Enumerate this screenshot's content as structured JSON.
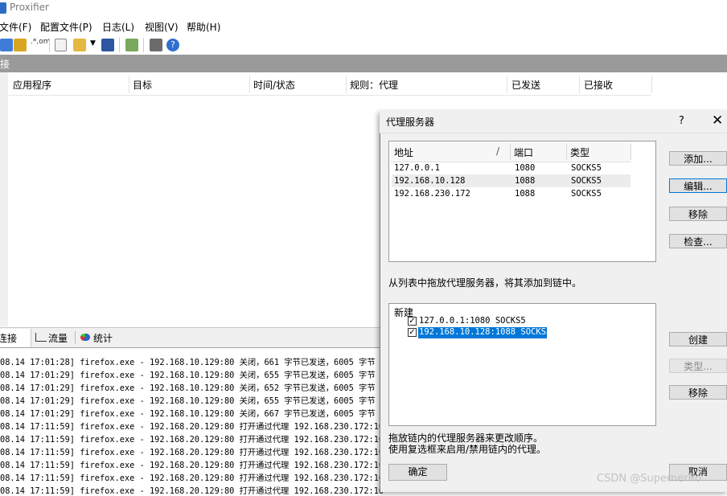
{
  "app": {
    "title": "Proxifier"
  },
  "menu": [
    "文件(F)",
    "配置文件(P)",
    "日志(L)",
    "视图(V)",
    "帮助(H)"
  ],
  "toolbar_icons": [
    "new-profile-icon",
    "log-icon",
    "dns-icon",
    "open-profile-icon",
    "open-folder-icon",
    "dropdown-arrow-icon",
    "save-icon",
    "export-icon",
    "print-icon",
    "help-icon"
  ],
  "connections": {
    "section_label": "接",
    "columns": [
      "应用程序",
      "目标",
      "时间/状态",
      "规则：代理",
      "已发送",
      "已接收"
    ]
  },
  "tabs": [
    {
      "label": "连接",
      "icon": "connections-icon"
    },
    {
      "label": "流量",
      "icon": "traffic-chart-icon"
    },
    {
      "label": "统计",
      "icon": "statistics-pie-icon"
    }
  ],
  "log": [
    "08.14 17:01:28] firefox.exe - 192.168.10.129:80 关闭，661 字节已发送，6005 字节",
    "08.14 17:01:29] firefox.exe - 192.168.10.129:80 关闭，655 字节已发送，6005 字节",
    "08.14 17:01:29] firefox.exe - 192.168.10.129:80 关闭，652 字节已发送，6005 字节",
    "08.14 17:01:29] firefox.exe - 192.168.10.129:80 关闭，655 字节已发送，6005 字节",
    "08.14 17:01:29] firefox.exe - 192.168.10.129:80 关闭，667 字节已发送，6005 字节",
    "08.14 17:11:59] firefox.exe - 192.168.20.129:80 打开通过代理 192.168.230.172:10",
    "08.14 17:11:59] firefox.exe - 192.168.20.129:80 打开通过代理 192.168.230.172:10",
    "08.14 17:11:59] firefox.exe - 192.168.20.129:80 打开通过代理 192.168.230.172:10",
    "08.14 17:11:59] firefox.exe - 192.168.20.129:80 打开通过代理 192.168.230.172:10",
    "08.14 17:11:59] firefox.exe - 192.168.20.129:80 打开通过代理 192.168.230.172:10",
    "08.14 17:11:59] firefox.exe - 192.168.20.129:80 打开通过代理 192.168.230.172:10"
  ],
  "dialog": {
    "title": "代理服务器",
    "help": "?",
    "close": "✕",
    "list_headers": {
      "address": "地址",
      "sort_mark": "/",
      "port": "端口",
      "type": "类型"
    },
    "proxies": [
      {
        "address": "127.0.0.1",
        "port": "1080",
        "type": "SOCKS5"
      },
      {
        "address": "192.168.10.128",
        "port": "1088",
        "type": "SOCKS5"
      },
      {
        "address": "192.168.230.172",
        "port": "1088",
        "type": "SOCKS5"
      }
    ],
    "buttons": {
      "add": "添加...",
      "edit": "编辑...",
      "remove": "移除",
      "check": "检查..."
    },
    "hint_drag": "从列表中拖放代理服务器，将其添加到链中。",
    "chain": {
      "title": "新建",
      "items": [
        {
          "label": "127.0.0.1:1080 SOCKS5",
          "checked": true
        },
        {
          "label": "192.168.10.128:1088 SOCKS5",
          "checked": true
        }
      ]
    },
    "chain_buttons": {
      "create": "创建",
      "type": "类型...",
      "remove": "移除"
    },
    "hint_order_1": "拖放链内的代理服务器来更改顺序。",
    "hint_order_2": "使用复选框来启用/禁用链内的代理。",
    "ok": "确定",
    "cancel": "取消"
  },
  "watermark": "CSDN @SupernerRo"
}
